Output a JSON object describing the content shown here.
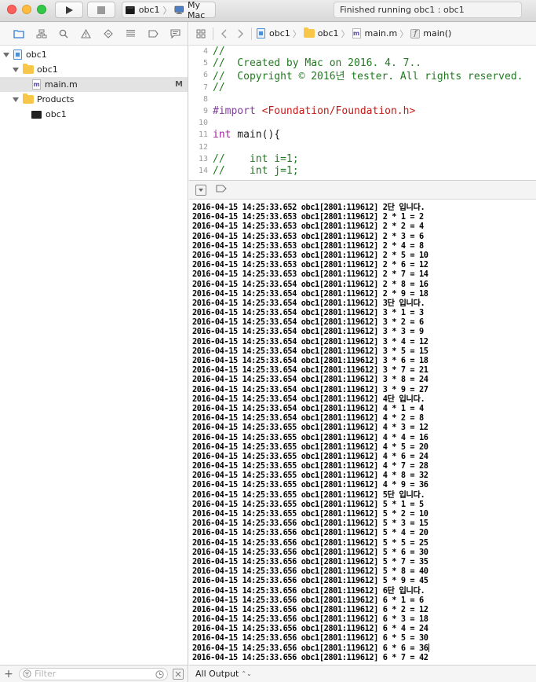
{
  "window": {
    "scheme_project": "obc1",
    "scheme_device": "My Mac",
    "status": "Finished running obc1 : obc1"
  },
  "navigator": {
    "tabs": [
      "project-navigator",
      "symbol-navigator",
      "find-navigator",
      "issue-navigator",
      "test-navigator",
      "debug-navigator",
      "breakpoint-navigator",
      "report-navigator"
    ],
    "tree": [
      {
        "label": "obc1",
        "kind": "project",
        "depth": 0,
        "expanded": true
      },
      {
        "label": "obc1",
        "kind": "folder",
        "depth": 1,
        "expanded": true
      },
      {
        "label": "main.m",
        "kind": "file",
        "depth": 2,
        "selected": true,
        "badge": "M"
      },
      {
        "label": "Products",
        "kind": "folder",
        "depth": 1,
        "expanded": true
      },
      {
        "label": "obc1",
        "kind": "executable",
        "depth": 2
      }
    ],
    "filter_placeholder": "Filter"
  },
  "jumpbar": {
    "crumbs": [
      "obc1",
      "obc1",
      "main.m",
      "main()"
    ]
  },
  "editor": {
    "lines": [
      {
        "num": "4",
        "text": "//"
      },
      {
        "num": "5",
        "text": "//  Created by Mac on 2016. 4. 7.."
      },
      {
        "num": "6",
        "text": "//  Copyright © 2016년 tester. All rights reserved."
      },
      {
        "num": "7",
        "text": "//"
      },
      {
        "num": "8",
        "text": ""
      },
      {
        "num": "9",
        "text": "#import <Foundation/Foundation.h>"
      },
      {
        "num": "10",
        "text": ""
      },
      {
        "num": "11",
        "text": "int main(){"
      },
      {
        "num": "12",
        "text": ""
      },
      {
        "num": "13",
        "text": "//    int i=1;"
      },
      {
        "num": "14",
        "text": "//    int j=1;"
      }
    ]
  },
  "console": {
    "lines": [
      "2016-04-15 14:25:33.652 obc1[2801:119612] 2단 입니다.",
      "2016-04-15 14:25:33.653 obc1[2801:119612] 2 * 1 = 2",
      "2016-04-15 14:25:33.653 obc1[2801:119612] 2 * 2 = 4",
      "2016-04-15 14:25:33.653 obc1[2801:119612] 2 * 3 = 6",
      "2016-04-15 14:25:33.653 obc1[2801:119612] 2 * 4 = 8",
      "2016-04-15 14:25:33.653 obc1[2801:119612] 2 * 5 = 10",
      "2016-04-15 14:25:33.653 obc1[2801:119612] 2 * 6 = 12",
      "2016-04-15 14:25:33.653 obc1[2801:119612] 2 * 7 = 14",
      "2016-04-15 14:25:33.654 obc1[2801:119612] 2 * 8 = 16",
      "2016-04-15 14:25:33.654 obc1[2801:119612] 2 * 9 = 18",
      "2016-04-15 14:25:33.654 obc1[2801:119612] 3단 입니다.",
      "2016-04-15 14:25:33.654 obc1[2801:119612] 3 * 1 = 3",
      "2016-04-15 14:25:33.654 obc1[2801:119612] 3 * 2 = 6",
      "2016-04-15 14:25:33.654 obc1[2801:119612] 3 * 3 = 9",
      "2016-04-15 14:25:33.654 obc1[2801:119612] 3 * 4 = 12",
      "2016-04-15 14:25:33.654 obc1[2801:119612] 3 * 5 = 15",
      "2016-04-15 14:25:33.654 obc1[2801:119612] 3 * 6 = 18",
      "2016-04-15 14:25:33.654 obc1[2801:119612] 3 * 7 = 21",
      "2016-04-15 14:25:33.654 obc1[2801:119612] 3 * 8 = 24",
      "2016-04-15 14:25:33.654 obc1[2801:119612] 3 * 9 = 27",
      "2016-04-15 14:25:33.654 obc1[2801:119612] 4단 입니다.",
      "2016-04-15 14:25:33.654 obc1[2801:119612] 4 * 1 = 4",
      "2016-04-15 14:25:33.654 obc1[2801:119612] 4 * 2 = 8",
      "2016-04-15 14:25:33.655 obc1[2801:119612] 4 * 3 = 12",
      "2016-04-15 14:25:33.655 obc1[2801:119612] 4 * 4 = 16",
      "2016-04-15 14:25:33.655 obc1[2801:119612] 4 * 5 = 20",
      "2016-04-15 14:25:33.655 obc1[2801:119612] 4 * 6 = 24",
      "2016-04-15 14:25:33.655 obc1[2801:119612] 4 * 7 = 28",
      "2016-04-15 14:25:33.655 obc1[2801:119612] 4 * 8 = 32",
      "2016-04-15 14:25:33.655 obc1[2801:119612] 4 * 9 = 36",
      "2016-04-15 14:25:33.655 obc1[2801:119612] 5단 입니다.",
      "2016-04-15 14:25:33.655 obc1[2801:119612] 5 * 1 = 5",
      "2016-04-15 14:25:33.655 obc1[2801:119612] 5 * 2 = 10",
      "2016-04-15 14:25:33.656 obc1[2801:119612] 5 * 3 = 15",
      "2016-04-15 14:25:33.656 obc1[2801:119612] 5 * 4 = 20",
      "2016-04-15 14:25:33.656 obc1[2801:119612] 5 * 5 = 25",
      "2016-04-15 14:25:33.656 obc1[2801:119612] 5 * 6 = 30",
      "2016-04-15 14:25:33.656 obc1[2801:119612] 5 * 7 = 35",
      "2016-04-15 14:25:33.656 obc1[2801:119612] 5 * 8 = 40",
      "2016-04-15 14:25:33.656 obc1[2801:119612] 5 * 9 = 45",
      "2016-04-15 14:25:33.656 obc1[2801:119612] 6단 입니다.",
      "2016-04-15 14:25:33.656 obc1[2801:119612] 6 * 1 = 6",
      "2016-04-15 14:25:33.656 obc1[2801:119612] 6 * 2 = 12",
      "2016-04-15 14:25:33.656 obc1[2801:119612] 6 * 3 = 18",
      "2016-04-15 14:25:33.656 obc1[2801:119612] 6 * 4 = 24",
      "2016-04-15 14:25:33.656 obc1[2801:119612] 6 * 5 = 30",
      "2016-04-15 14:25:33.656 obc1[2801:119612] 6 * 6 = 36",
      "2016-04-15 14:25:33.656 obc1[2801:119612] 6 * 7 = 42"
    ],
    "output_filter": "All Output"
  },
  "colors": {
    "comment": "#217a21",
    "preprocessor": "#7d3f98",
    "string": "#c41a16",
    "keyword": "#a2259f",
    "close": "#fc605c",
    "minimize": "#fdbc40",
    "zoom": "#34c84a"
  }
}
